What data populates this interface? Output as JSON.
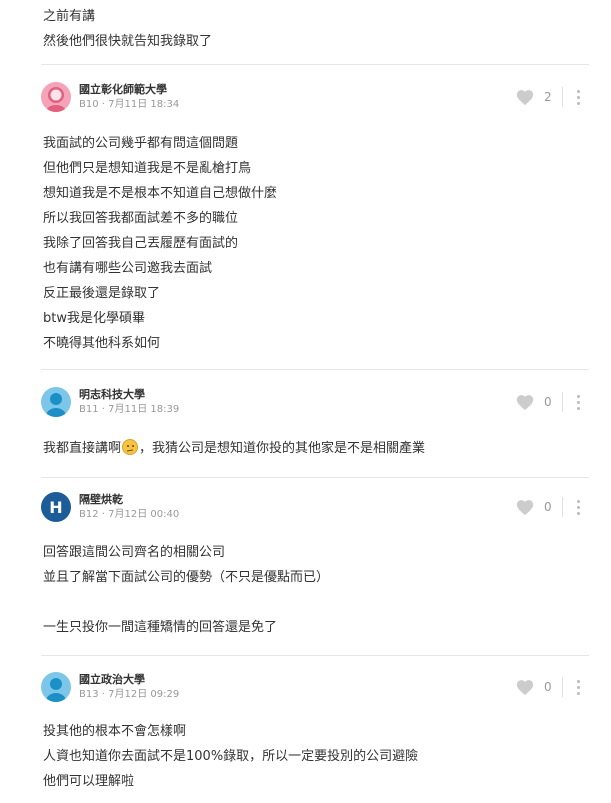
{
  "previous_tail": [
    "之前有講",
    "然後他們很快就告知我錄取了"
  ],
  "comments": [
    {
      "school": "國立彰化師範大學",
      "floor": "B10",
      "time": "7月11日 18:34",
      "likes": "2",
      "avatar": "female",
      "lines": [
        "我面試的公司幾乎都有問這個問題",
        "但他們只是想知道我是不是亂槍打鳥",
        "想知道我是不是根本不知道自己想做什麼",
        "所以我回答我都面試差不多的職位",
        "我除了回答我自己丟履歷有面試的",
        "也有講有哪些公司邀我去面試",
        "反正最後還是錄取了",
        "btw我是化學碩畢",
        "不曉得其他科系如何"
      ]
    },
    {
      "school": "明志科技大學",
      "floor": "B11",
      "time": "7月11日 18:39",
      "likes": "0",
      "avatar": "male",
      "line_before_emoji": "我都直接講啊",
      "line_after_emoji": "，我猜公司是想知道你投的其他家是不是相關產業",
      "emoji_icon": "thinking-face"
    },
    {
      "school": "隔壁烘乾",
      "floor": "B12",
      "time": "7月12日 00:40",
      "likes": "0",
      "avatar": "letter",
      "avatar_letter": "H",
      "lines": [
        "回答跟這間公司齊名的相關公司",
        "並且了解當下面試公司的優勢（不只是優點而已）",
        "",
        "一生只投你一間這種矯情的回答還是免了"
      ]
    },
    {
      "school": "國立政治大學",
      "floor": "B13",
      "time": "7月12日 09:29",
      "likes": "0",
      "avatar": "male",
      "lines": [
        "投其他的根本不會怎樣啊",
        "人資也知道你去面試不是100%錄取，所以一定要投別的公司避險",
        "他們可以理解啦"
      ]
    }
  ],
  "icons": {
    "like": "heart-icon",
    "more": "more-vertical-icon"
  },
  "colors": {
    "text": "#333333",
    "meta": "#999999",
    "divider": "#e6e6e6",
    "heart": "#cccccc"
  }
}
